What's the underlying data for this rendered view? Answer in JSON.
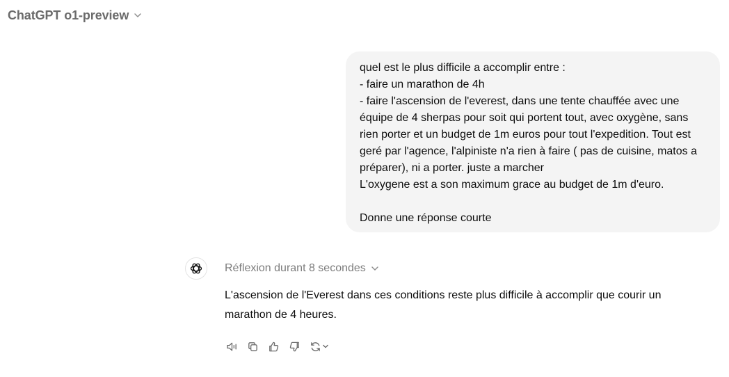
{
  "header": {
    "model_name": "ChatGPT o1-preview"
  },
  "user_message": {
    "lines": [
      "quel est le plus difficile a accomplir entre :",
      "- faire un marathon de 4h",
      "- faire l'ascension de l'everest, dans une tente chauffée avec une",
      "équipe de 4 sherpas pour soit qui portent tout, avec oxygène, sans",
      "rien porter et un budget de 1m euros pour tout l'expedition. Tout est",
      "geré par l'agence, l'alpiniste n'a rien à faire ( pas de cuisine, matos a",
      "préparer), ni a porter. juste a marcher",
      "L'oxygene est a son maximum grace au budget de 1m d'euro.",
      "",
      "Donne une réponse courte"
    ]
  },
  "assistant": {
    "thinking_label": "Réflexion durant 8 secondes",
    "answer_line1": "L'ascension de l'Everest dans ces conditions reste plus difficile à accomplir que courir un",
    "answer_line2": "marathon de 4 heures.",
    "actions": [
      "read-aloud-icon",
      "copy-icon",
      "thumbs-up-icon",
      "thumbs-down-icon",
      "regenerate-icon"
    ]
  },
  "colors": {
    "bubble": "#f4f4f4",
    "muted_text": "#7d7d7d",
    "icon": "#6b6b6b"
  }
}
